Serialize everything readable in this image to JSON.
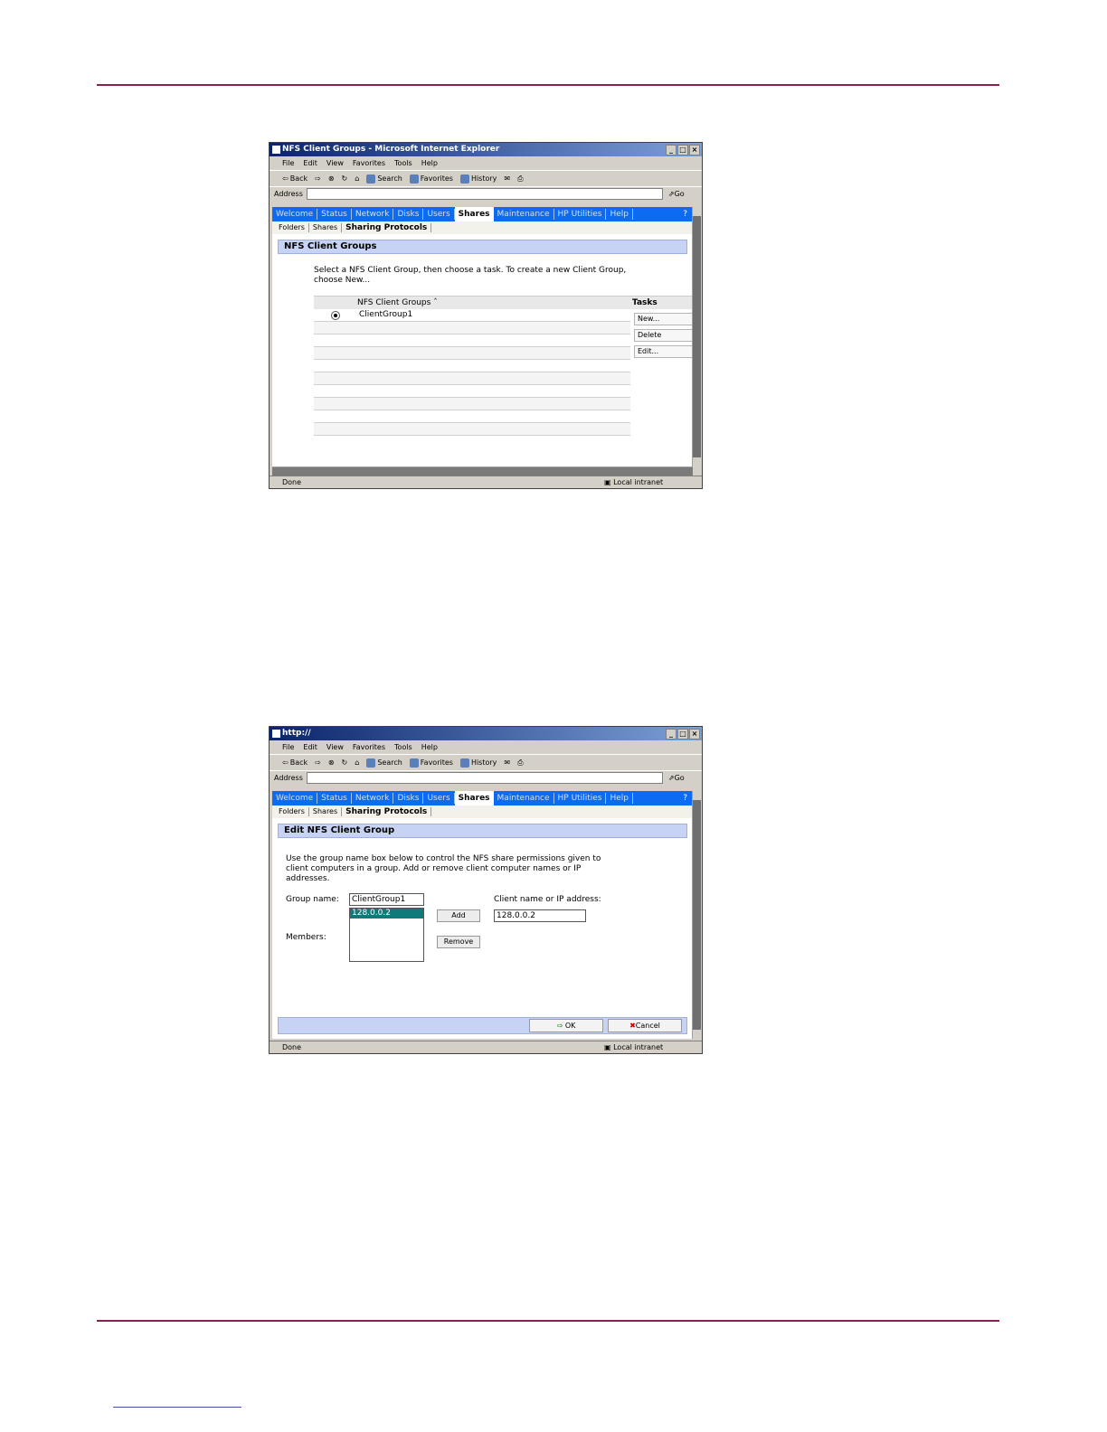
{
  "document": {
    "nav_tabs": [
      "Welcome",
      "Status",
      "Network",
      "Disks",
      "Users",
      "Shares",
      "Maintenance",
      "HP Utilities",
      "Help"
    ],
    "help_icon": "?",
    "sub_tabs": [
      "Folders",
      "Shares",
      "Sharing Protocols"
    ]
  },
  "browser": {
    "menus": [
      "File",
      "Edit",
      "View",
      "Favorites",
      "Tools",
      "Help"
    ],
    "toolbar": {
      "back": "Back",
      "search": "Search",
      "favorites": "Favorites",
      "history": "History"
    },
    "address_label": "Address",
    "go_label": "Go",
    "status_done": "Done",
    "status_zone": "Local intranet"
  },
  "window1": {
    "title": "NFS Client Groups - Microsoft Internet Explorer",
    "section_title": "NFS Client Groups",
    "instructions": "Select a NFS Client Group, then choose a task. To create a new Client Group, choose New...",
    "grid_header": "NFS Client Groups",
    "sort_icon": "sort-ascending-icon",
    "rows": [
      "ClientGroup1",
      "",
      "",
      "",
      "",
      "",
      "",
      "",
      "",
      ""
    ],
    "tasks_header": "Tasks",
    "tasks": [
      "New...",
      "Delete",
      "Edit..."
    ]
  },
  "window2": {
    "title": "http://",
    "section_title": "Edit NFS Client Group",
    "instructions": "Use the group name box below to control the NFS share permissions given to client computers in a group. Add or remove client computer names or IP addresses.",
    "group_name_label": "Group name:",
    "group_name_value": "ClientGroup1",
    "members_label": "Members:",
    "members": [
      "128.0.0.2"
    ],
    "add_label": "Add",
    "remove_label": "Remove",
    "client_label": "Client name or IP address:",
    "client_value": "128.0.0.2",
    "ok_label": "OK",
    "cancel_label": "Cancel"
  },
  "colors": {
    "nav_blue": "#0d6bf1",
    "rule": "#8b1f4f",
    "section_bg": "#c6d3f5",
    "selected_member": "#0f7a7a"
  }
}
